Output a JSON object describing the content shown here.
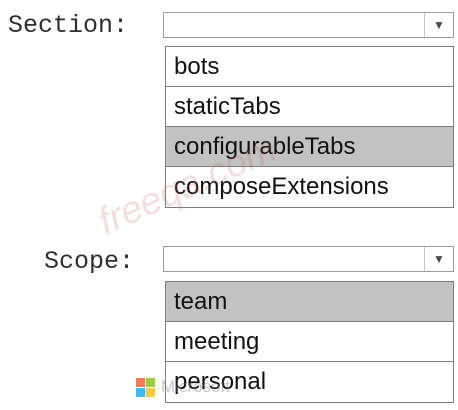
{
  "section": {
    "label": "Section:",
    "selected_value": "",
    "options": [
      "bots",
      "staticTabs",
      "configurableTabs",
      "composeExtensions"
    ],
    "highlighted": "configurableTabs"
  },
  "scope": {
    "label": "Scope:",
    "selected_value": "",
    "options": [
      "team",
      "meeting",
      "personal"
    ],
    "highlighted": "team"
  },
  "watermark": {
    "text": "freeqa.com",
    "logo_text": "Microsoft",
    "logo_colors": [
      "#f25022",
      "#7fba00",
      "#00a4ef",
      "#ffb900"
    ]
  },
  "colors": {
    "highlight": "#c2c2c2",
    "border": "#7d7d7d"
  }
}
